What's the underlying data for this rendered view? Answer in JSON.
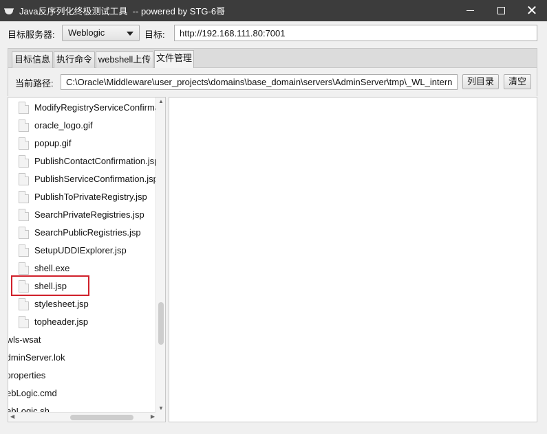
{
  "window": {
    "title": "Java反序列化终极测试工具  -- powered by STG-6哥"
  },
  "target": {
    "server_label": "目标服务器:",
    "server_value": "Weblogic",
    "url_label": "目标:",
    "url_value": "http://192.168.111.80:7001"
  },
  "tabs": [
    {
      "label": "目标信息"
    },
    {
      "label": "执行命令"
    },
    {
      "label": "webshell上传"
    },
    {
      "label": "文件管理"
    }
  ],
  "file_manager": {
    "path_label": "当前路径:",
    "path_value": "C:\\Oracle\\Middleware\\user_projects\\domains\\base_domain\\servers\\AdminServer\\tmp\\_WL_intern",
    "list_button": "列目录",
    "clear_button": "清空"
  },
  "tree": {
    "files": [
      "ModifyRegistryServiceConfirmation.jsp",
      "oracle_logo.gif",
      "popup.gif",
      "PublishContactConfirmation.jsp",
      "PublishServiceConfirmation.jsp",
      "PublishToPrivateRegistry.jsp",
      "SearchPrivateRegistries.jsp",
      "SearchPublicRegistries.jsp",
      "SetupUDDIExplorer.jsp",
      "shell.exe",
      "shell.jsp",
      "stylesheet.jsp",
      "topheader.jsp"
    ],
    "folders": [
      "/wls-wsat",
      "AdminServer.lok",
      "m.properties",
      "WebLogic.cmd",
      "WebLogic.sh"
    ],
    "highlighted": "shell.jsp"
  }
}
